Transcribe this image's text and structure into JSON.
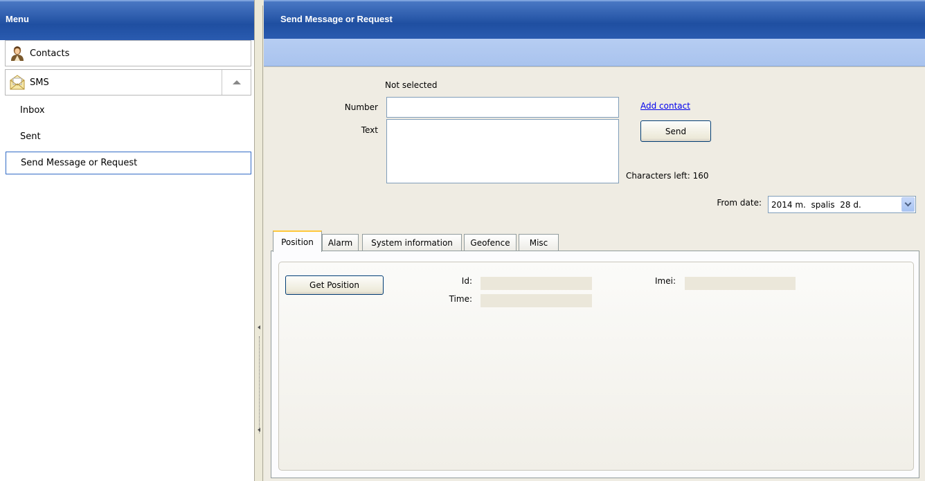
{
  "menu": {
    "title": "Menu",
    "contacts_label": "Contacts",
    "sms_label": "SMS",
    "sub_items": [
      {
        "label": "Inbox"
      },
      {
        "label": "Sent"
      },
      {
        "label": "Send Message or Request"
      }
    ]
  },
  "main": {
    "title": "Send Message or Request",
    "form": {
      "status": "Not selected",
      "number_label": "Number",
      "number_value": "",
      "text_label": "Text",
      "text_value": "",
      "add_contact": "Add contact",
      "send": "Send",
      "chars_left": "Characters left: 160",
      "from_date_label": "From date:",
      "from_date_value": "2014 m.  spalis  28 d."
    },
    "tabs": [
      {
        "label": "Position"
      },
      {
        "label": "Alarm"
      },
      {
        "label": "System information"
      },
      {
        "label": "Geofence"
      },
      {
        "label": "Misc"
      }
    ],
    "position": {
      "get_position": "Get Position",
      "id_label": "Id:",
      "time_label": "Time:",
      "imei_label": "Imei:"
    }
  },
  "colors": {
    "header_blue": "#1f4fa1",
    "selection_border": "#316ac5",
    "active_tab_accent": "#ffc83c"
  },
  "icons": {
    "contacts": "person-icon",
    "sms": "envelope-icon"
  }
}
